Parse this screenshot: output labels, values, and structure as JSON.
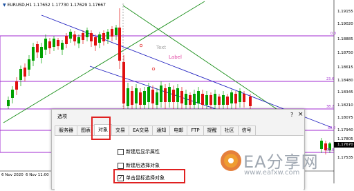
{
  "chart": {
    "symbol_header": "EURUSD,H1  1.17652 1.17730 1.17629 1.17667",
    "price_labels": [
      "1.19155",
      "1.19020",
      "1.18885",
      "1.18750",
      "1.18615",
      "1.18480",
      "1.18345",
      "1.18210",
      "1.18075",
      "1.17940",
      "1.17805",
      "1.17670",
      "1.17535"
    ],
    "date_labels": [
      "6 Nov 2020",
      "6 Nov 11:00"
    ],
    "fibo_labels": [
      "0.0",
      "23.6",
      "38.2",
      "50.0",
      "61.8"
    ],
    "text_object": "Text",
    "label_object": "Label",
    "colors": {
      "fibo": "#a02ad0",
      "channel": "#2020c0",
      "trend": "#1a8f1a",
      "bull": "#00a000",
      "bear": "#e01010",
      "highlight": "#e02020"
    }
  },
  "dialog": {
    "title": "选项",
    "help_icon": "?",
    "close_icon": "×",
    "tabs": [
      "服务器",
      "图表",
      "对象",
      "交易",
      "EA交易",
      "通知",
      "电邮",
      "FTP",
      "提醒",
      "社区",
      "信号"
    ],
    "active_tab": "对象",
    "options": [
      {
        "label": "新建后显示属性",
        "checked": false
      },
      {
        "label": "新建后选择对象",
        "checked": false
      },
      {
        "label": "单击鼠标选择对象",
        "checked": true
      }
    ]
  },
  "watermark": {
    "text": "EA分享网",
    "url": "www.eafxw.com"
  }
}
